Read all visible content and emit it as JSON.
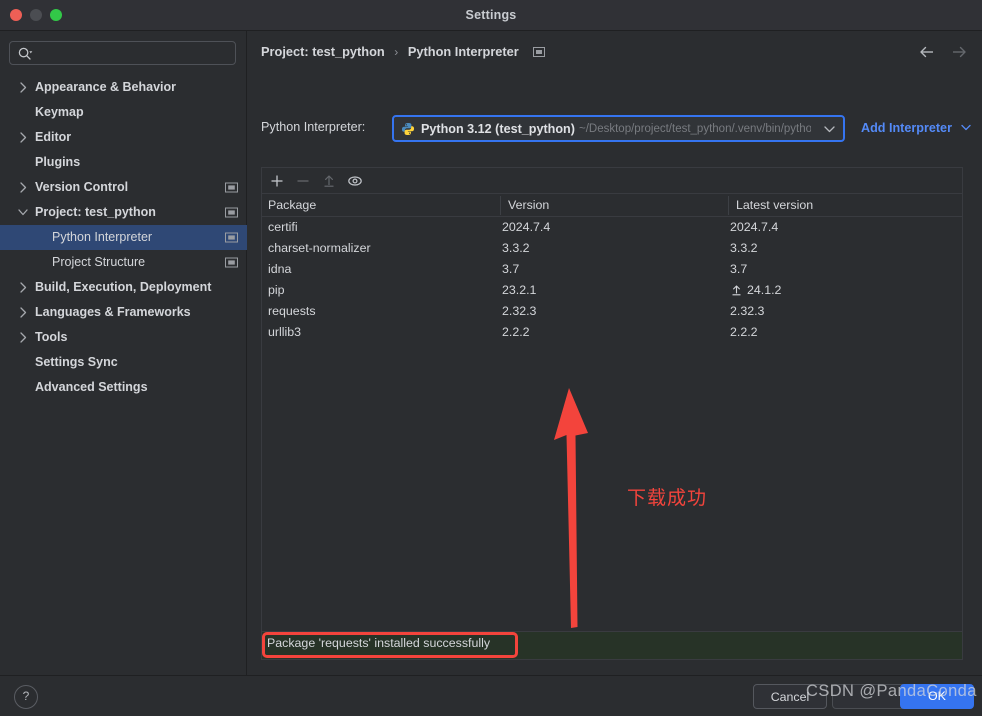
{
  "window": {
    "title": "Settings",
    "traffic_lights": [
      "close-red",
      "minimize-gray",
      "zoom-green"
    ]
  },
  "sidebar": {
    "search": {
      "value": "",
      "placeholder": ""
    },
    "items": [
      {
        "label": "Appearance & Behavior",
        "level": 0,
        "expandable": true,
        "expanded": false,
        "selected": false,
        "glyph": false
      },
      {
        "label": "Keymap",
        "level": 0,
        "expandable": false,
        "expanded": false,
        "selected": false,
        "glyph": false
      },
      {
        "label": "Editor",
        "level": 0,
        "expandable": true,
        "expanded": false,
        "selected": false,
        "glyph": false
      },
      {
        "label": "Plugins",
        "level": 0,
        "expandable": false,
        "expanded": false,
        "selected": false,
        "glyph": false
      },
      {
        "label": "Version Control",
        "level": 0,
        "expandable": true,
        "expanded": false,
        "selected": false,
        "glyph": true
      },
      {
        "label": "Project: test_python",
        "level": 0,
        "expandable": true,
        "expanded": true,
        "selected": false,
        "glyph": true
      },
      {
        "label": "Python Interpreter",
        "level": 1,
        "expandable": false,
        "expanded": false,
        "selected": true,
        "glyph": true
      },
      {
        "label": "Project Structure",
        "level": 1,
        "expandable": false,
        "expanded": false,
        "selected": false,
        "glyph": true
      },
      {
        "label": "Build, Execution, Deployment",
        "level": 0,
        "expandable": true,
        "expanded": false,
        "selected": false,
        "glyph": false
      },
      {
        "label": "Languages & Frameworks",
        "level": 0,
        "expandable": true,
        "expanded": false,
        "selected": false,
        "glyph": false
      },
      {
        "label": "Tools",
        "level": 0,
        "expandable": true,
        "expanded": false,
        "selected": false,
        "glyph": false
      },
      {
        "label": "Settings Sync",
        "level": 0,
        "expandable": false,
        "expanded": false,
        "selected": false,
        "glyph": false
      },
      {
        "label": "Advanced Settings",
        "level": 0,
        "expandable": false,
        "expanded": false,
        "selected": false,
        "glyph": false
      }
    ]
  },
  "breadcrumb": {
    "root": "Project: test_python",
    "separator": "›",
    "leaf": "Python Interpreter"
  },
  "nav": {
    "back": "back-arrow",
    "forward": "forward-arrow"
  },
  "interpreter": {
    "label": "Python Interpreter:",
    "value": "Python 3.12 (test_python)",
    "path": "~/Desktop/project/test_python/.venv/bin/python",
    "add_label": "Add Interpreter"
  },
  "packages": {
    "toolbar": [
      "add-icon",
      "remove-icon",
      "upgrade-icon",
      "show-early-releases-icon"
    ],
    "columns": [
      "Package",
      "Version",
      "Latest version"
    ],
    "rows": [
      {
        "package": "certifi",
        "version": "2024.7.4",
        "latest": "2024.7.4",
        "upgradable": false
      },
      {
        "package": "charset-normalizer",
        "version": "3.3.2",
        "latest": "3.3.2",
        "upgradable": false
      },
      {
        "package": "idna",
        "version": "3.7",
        "latest": "3.7",
        "upgradable": false
      },
      {
        "package": "pip",
        "version": "23.2.1",
        "latest": "24.1.2",
        "upgradable": true
      },
      {
        "package": "requests",
        "version": "2.32.3",
        "latest": "2.32.3",
        "upgradable": false
      },
      {
        "package": "urllib3",
        "version": "2.2.2",
        "latest": "2.2.2",
        "upgradable": false
      }
    ]
  },
  "status": {
    "message": "Package 'requests' installed successfully",
    "highlight_color": "#f3443c",
    "strip_color": "#273327"
  },
  "footer": {
    "help": "?",
    "cancel": "Cancel",
    "ok": "OK"
  },
  "annotations": {
    "arrow_color": "#f3443c",
    "note": "下载成功",
    "watermark": "CSDN @PandaConda"
  }
}
